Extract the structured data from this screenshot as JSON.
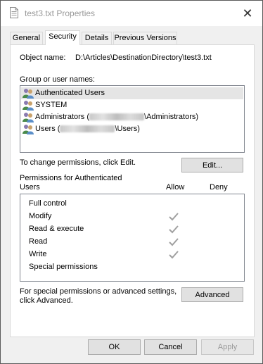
{
  "window": {
    "title": "test3.txt Properties"
  },
  "tabs": [
    {
      "label": "General",
      "active": false
    },
    {
      "label": "Security",
      "active": true
    },
    {
      "label": "Details",
      "active": false
    },
    {
      "label": "Previous Versions",
      "active": false
    }
  ],
  "security": {
    "object_name_label": "Object name:",
    "object_name_value": "D:\\Articles\\DestinationDirectory\\test3.txt",
    "group_label": "Group or user names:",
    "users": [
      {
        "name": "Authenticated Users",
        "selected": true
      },
      {
        "name": "SYSTEM",
        "selected": false
      },
      {
        "prefix": "Administrators (",
        "suffix": "\\Administrators)",
        "selected": false
      },
      {
        "prefix": "Users (",
        "suffix": "\\Users)",
        "selected": false
      }
    ],
    "change_text": "To change permissions, click Edit.",
    "edit_button": "Edit...",
    "permissions_header_line1": "Permissions for Authenticated",
    "permissions_header_line2": "Users",
    "allow_header": "Allow",
    "deny_header": "Deny",
    "permissions": [
      {
        "name": "Full control",
        "allow": false,
        "deny": false
      },
      {
        "name": "Modify",
        "allow": true,
        "deny": false
      },
      {
        "name": "Read & execute",
        "allow": true,
        "deny": false
      },
      {
        "name": "Read",
        "allow": true,
        "deny": false
      },
      {
        "name": "Write",
        "allow": true,
        "deny": false
      },
      {
        "name": "Special permissions",
        "allow": false,
        "deny": false
      }
    ],
    "advanced_text_line1": "For special permissions or advanced settings,",
    "advanced_text_line2": "click Advanced.",
    "advanced_button": "Advanced"
  },
  "footer": {
    "ok": "OK",
    "cancel": "Cancel",
    "apply": "Apply",
    "apply_enabled": false
  },
  "colors": {
    "check": "#a0a0a0",
    "selection": "#e5e5e5"
  },
  "icons": {
    "doc": "document-icon",
    "close": "close-icon",
    "user": "users-icon",
    "check": "checkmark-icon"
  }
}
